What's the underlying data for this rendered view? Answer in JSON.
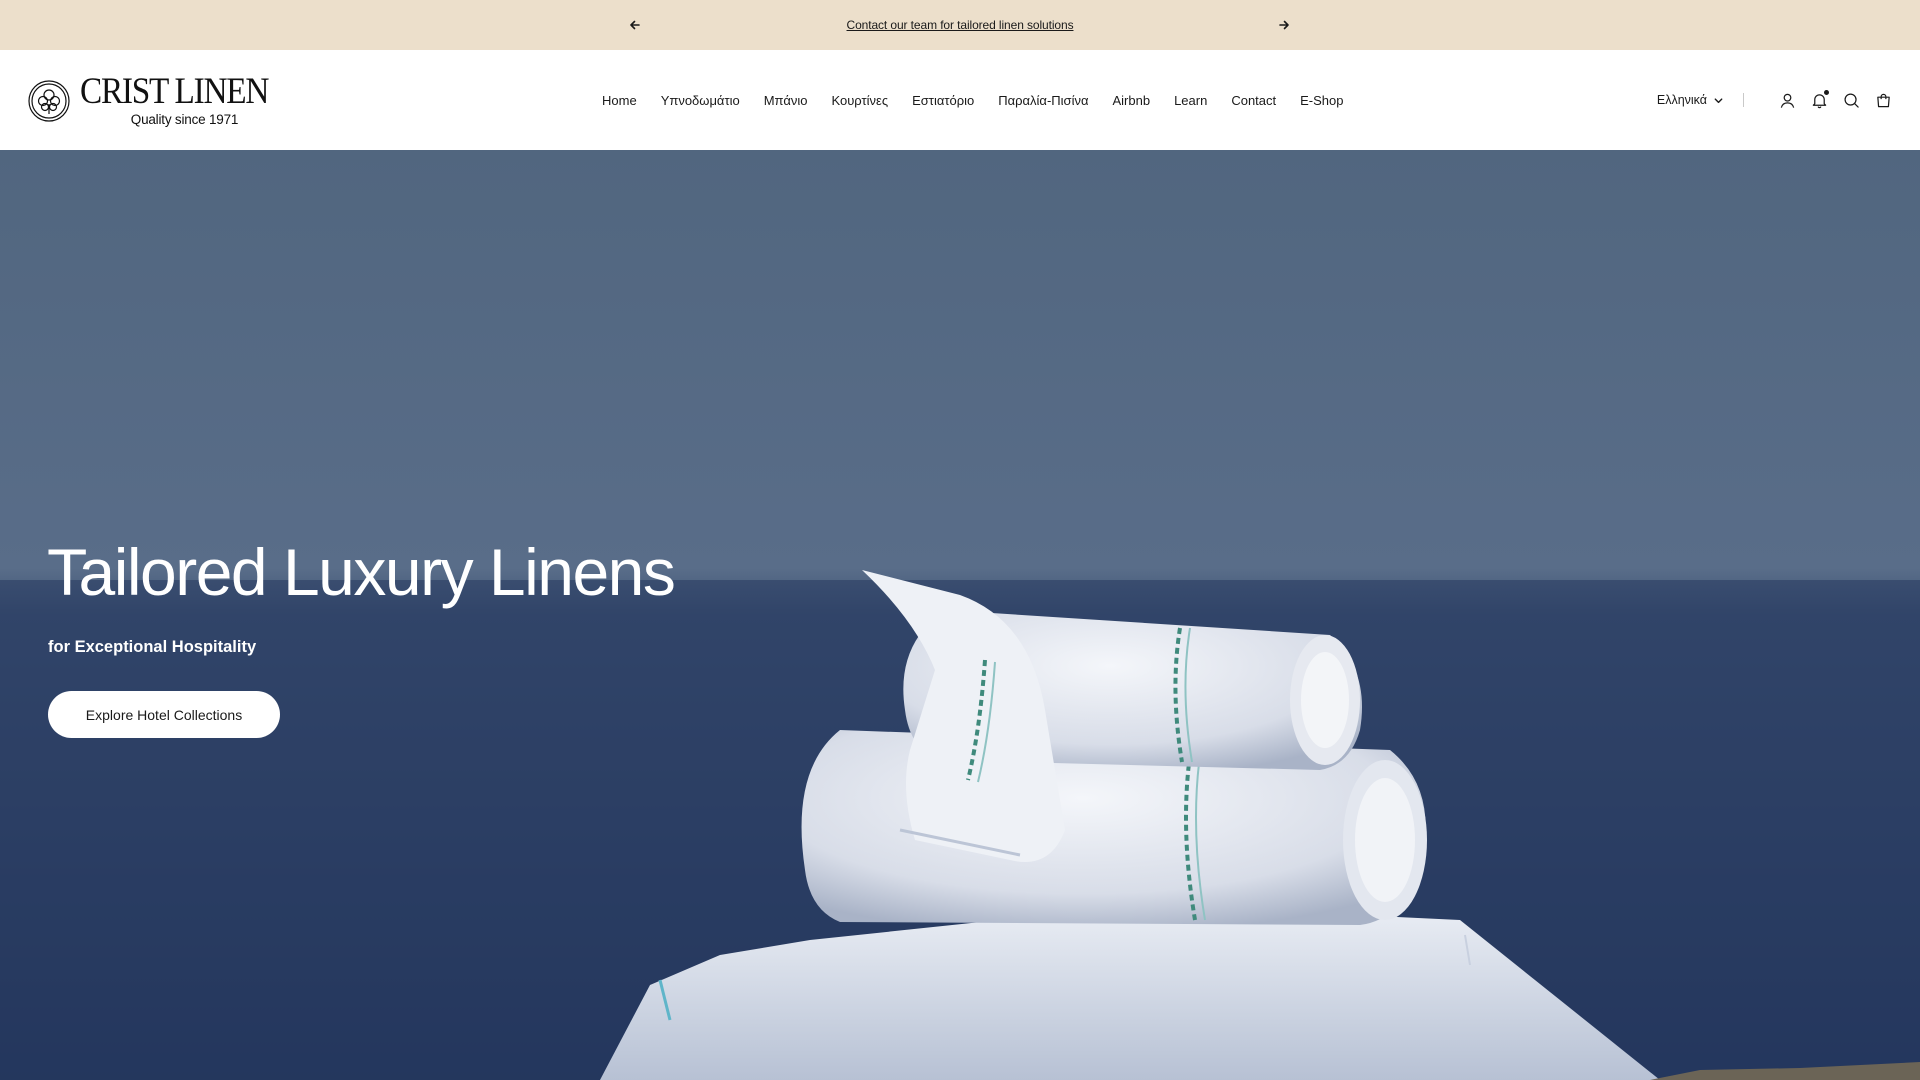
{
  "announcement": {
    "message": "Contact our team for tailored linen solutions",
    "prev_icon": "arrow-left-icon",
    "next_icon": "arrow-right-icon",
    "background": "#ecdfcb"
  },
  "brand": {
    "name": "CRIST LINEN",
    "tagline": "Quality since 1971",
    "emblem_icon": "cotton-flower-emblem"
  },
  "nav": {
    "items": [
      {
        "label": "Home"
      },
      {
        "label": "Υπνοδωμάτιο"
      },
      {
        "label": "Μπάνιο"
      },
      {
        "label": "Κουρτίνες"
      },
      {
        "label": "Εστιατόριο"
      },
      {
        "label": "Παραλία-Πισίνα"
      },
      {
        "label": "Airbnb"
      },
      {
        "label": "Learn"
      },
      {
        "label": "Contact"
      },
      {
        "label": "E-Shop"
      }
    ]
  },
  "tools": {
    "language": "Ελληνικά",
    "icons": [
      "account-icon",
      "bell-icon",
      "search-icon",
      "cart-icon"
    ]
  },
  "hero": {
    "title": "Tailored Luxury Linens",
    "subtitle": "for Exceptional Hospitality",
    "button_label": "Explore Hotel Collections",
    "accent": "#22355c"
  }
}
